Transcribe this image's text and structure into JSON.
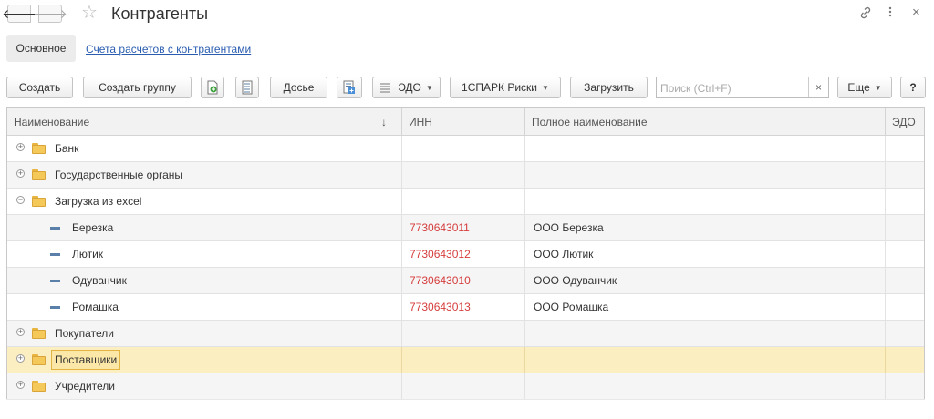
{
  "window": {
    "title": "Контрагенты",
    "icons": [
      "back-arrow-icon",
      "forward-arrow-icon",
      "star-icon",
      "link-icon",
      "more-vert-icon",
      "close-icon"
    ]
  },
  "tabs": {
    "main": "Основное",
    "link": "Счета расчетов с контрагентами"
  },
  "toolbar": {
    "create": "Создать",
    "create_group": "Создать группу",
    "dossier": "Досье",
    "edo": "ЭДО",
    "spark": "1СПАРК Риски",
    "load": "Загрузить",
    "search_placeholder": "Поиск (Ctrl+F)",
    "search_clear": "×",
    "more": "Еще",
    "help": "?"
  },
  "table": {
    "columns": {
      "name": "Наименование",
      "inn": "ИНН",
      "full_name": "Полное наименование",
      "edo": "ЭДО"
    },
    "sort_indicator": "↓",
    "rows": [
      {
        "type": "group",
        "expander": "⊕",
        "name": "Банк",
        "inn": "",
        "full": ""
      },
      {
        "type": "group",
        "expander": "⊕",
        "name": "Государственные органы",
        "inn": "",
        "full": ""
      },
      {
        "type": "group",
        "expander": "⊖",
        "name": "Загрузка из excel",
        "inn": "",
        "full": ""
      },
      {
        "type": "item",
        "name": "Березка",
        "inn": "7730643011",
        "full": "ООО Березка"
      },
      {
        "type": "item",
        "name": "Лютик",
        "inn": "7730643012",
        "full": "ООО Лютик"
      },
      {
        "type": "item",
        "name": "Одуванчик",
        "inn": "7730643010",
        "full": "ООО Одуванчик"
      },
      {
        "type": "item",
        "name": "Ромашка",
        "inn": "7730643013",
        "full": "ООО Ромашка"
      },
      {
        "type": "group",
        "expander": "⊕",
        "name": "Покупатели",
        "inn": "",
        "full": ""
      },
      {
        "type": "group",
        "expander": "⊕",
        "name": "Поставщики",
        "inn": "",
        "full": "",
        "selected": true
      },
      {
        "type": "group",
        "expander": "⊕",
        "name": "Учредители",
        "inn": "",
        "full": ""
      }
    ]
  },
  "colors": {
    "inn_text": "#d63c3c",
    "selection": "#fbeec1",
    "link": "#2a5db0",
    "folder": "#f5c85a"
  }
}
